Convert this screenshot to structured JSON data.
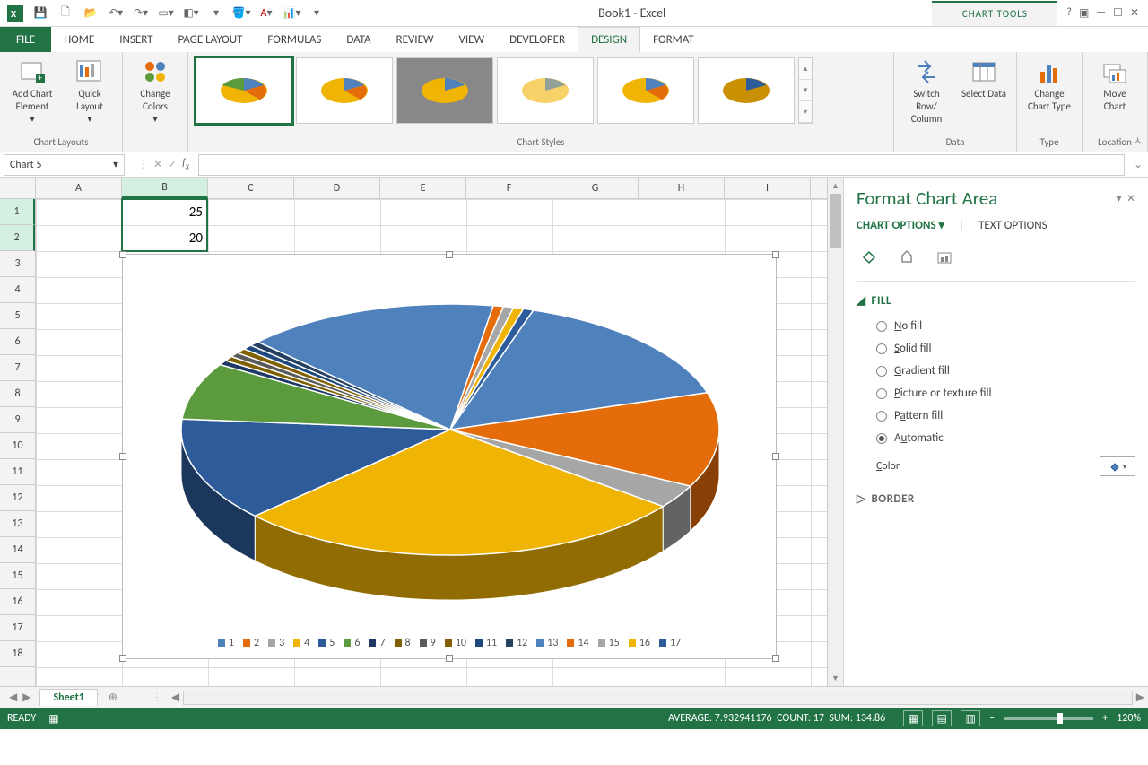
{
  "app": {
    "title": "Book1 - Excel",
    "tools_label": "CHART TOOLS"
  },
  "tabs": {
    "file": "FILE",
    "home": "HOME",
    "insert": "INSERT",
    "page": "PAGE LAYOUT",
    "formulas": "FORMULAS",
    "data": "DATA",
    "review": "REVIEW",
    "view": "VIEW",
    "developer": "DEVELOPER",
    "design": "DESIGN",
    "format": "FORMAT"
  },
  "ribbon": {
    "layouts": {
      "add_element": "Add Chart Element",
      "quick_layout": "Quick Layout",
      "group": "Chart Layouts"
    },
    "colors": {
      "change_colors": "Change Colors",
      "group": ""
    },
    "styles": {
      "group": "Chart Styles"
    },
    "data": {
      "switch": "Switch Row/ Column",
      "select": "Select Data",
      "group": "Data"
    },
    "type": {
      "change": "Change Chart Type",
      "group": "Type"
    },
    "location": {
      "move": "Move Chart",
      "group": "Location"
    }
  },
  "namebox": "Chart 5",
  "cells": {
    "B1": "25",
    "B2": "20"
  },
  "columns": [
    "A",
    "B",
    "C",
    "D",
    "E",
    "F",
    "G",
    "H",
    "I"
  ],
  "rows": [
    "1",
    "2",
    "3",
    "4",
    "5",
    "6",
    "7",
    "8",
    "9",
    "10",
    "11",
    "12",
    "13",
    "14",
    "15",
    "16",
    "17",
    "18"
  ],
  "sheet": {
    "tab": "Sheet1"
  },
  "status": {
    "ready": "READY",
    "average": "AVERAGE: 7.932941176",
    "count": "COUNT: 17",
    "sum": "SUM: 134.86",
    "zoom": "120%"
  },
  "pane": {
    "title": "Format Chart Area",
    "chart_options": "CHART OPTIONS",
    "text_options": "TEXT OPTIONS",
    "fill": "FILL",
    "no_fill": "No fill",
    "solid": "Solid fill",
    "gradient": "Gradient fill",
    "picture": "Picture or texture fill",
    "pattern": "Pattern fill",
    "automatic": "Automatic",
    "color": "Color",
    "border": "BORDER"
  },
  "chart_data": {
    "type": "pie",
    "categories": [
      "1",
      "2",
      "3",
      "4",
      "5",
      "6",
      "7",
      "8",
      "9",
      "10",
      "11",
      "12",
      "13",
      "14",
      "15",
      "16",
      "17"
    ],
    "values": [
      25,
      20,
      5,
      45,
      22,
      12,
      1,
      1,
      1,
      1,
      1,
      1,
      25,
      1,
      1,
      1,
      1
    ],
    "colors": [
      "#4f81bd",
      "#e46c0a",
      "#a6a6a6",
      "#f0b404",
      "#2e5c9a",
      "#5b9b3e",
      "#1f3864",
      "#7f6000",
      "#5a5a5a",
      "#806000",
      "#1f497d",
      "#254061",
      "#4f81bd",
      "#e46c0a",
      "#a6a6a6",
      "#f0b404",
      "#2e5c9a"
    ],
    "title": "",
    "legend_position": "bottom"
  }
}
